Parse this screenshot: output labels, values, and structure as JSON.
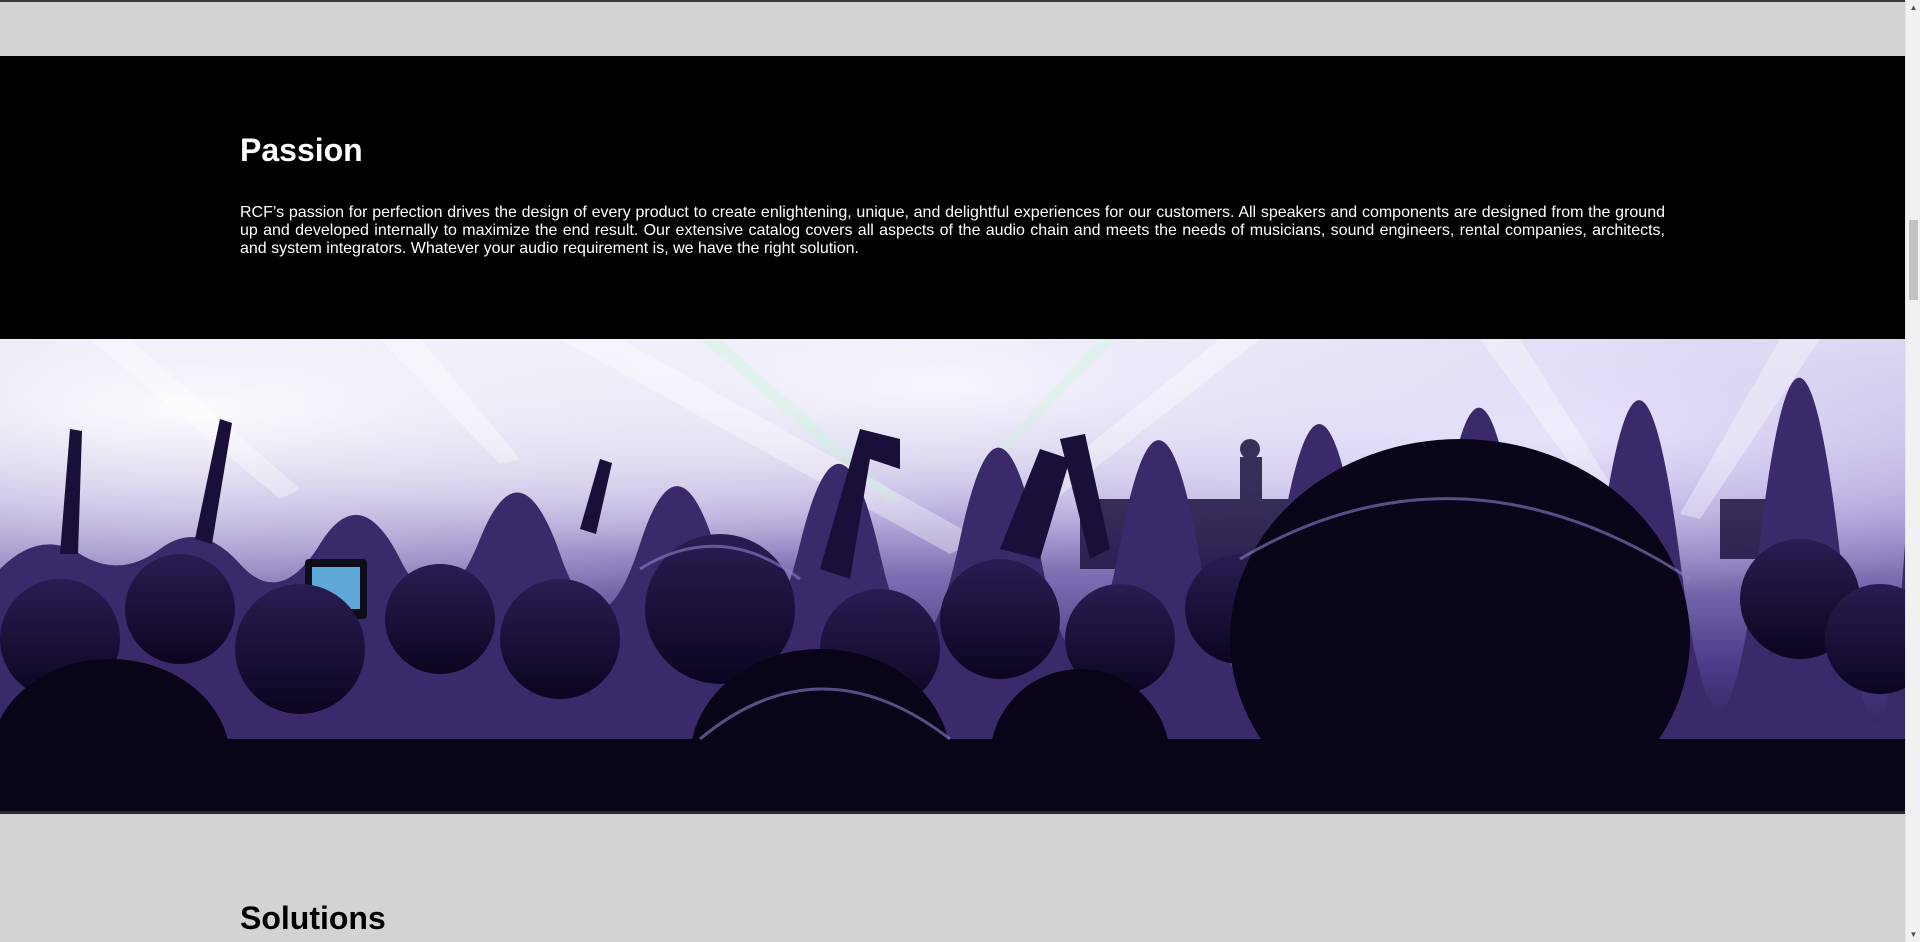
{
  "passion": {
    "heading": "Passion",
    "body": "RCF’s passion for perfection drives the design of every product to create enlightening, unique, and delightful experiences for our customers. All speakers and components are designed from the ground up and developed internally to maximize the end result. Our extensive catalog covers all aspects of the audio chain and meets the needs of musicians, sound engineers, rental companies, architects, and system integrators. Whatever your audio requirement is, we have the right solution."
  },
  "hero": {
    "image_subject": "concert crowd with stage lights"
  },
  "solutions": {
    "heading": "Solutions"
  },
  "scrollbar": {
    "up_icon": "triangle-up-icon",
    "down_icon": "triangle-down-icon"
  }
}
